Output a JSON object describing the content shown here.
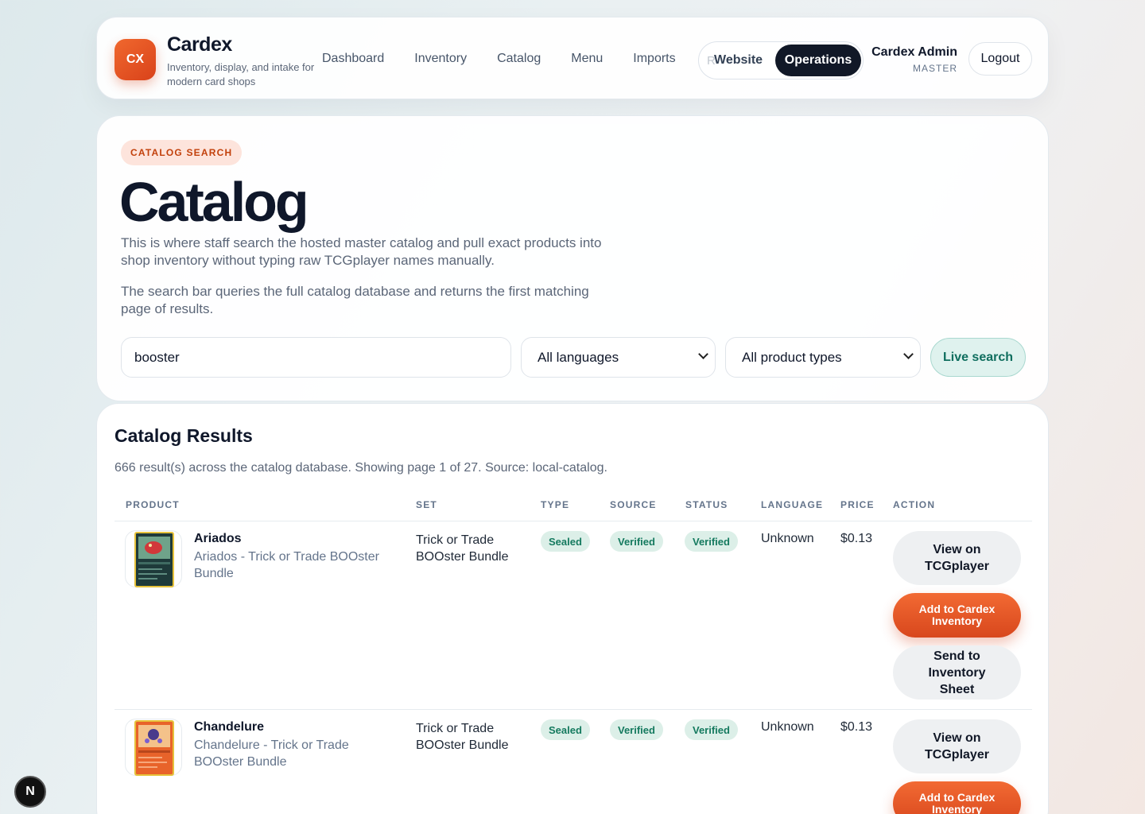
{
  "header": {
    "logo_text": "CX",
    "brand_name": "Cardex",
    "brand_tagline": "Inventory, display, and intake for modern card shops",
    "nav": [
      "Dashboard",
      "Inventory",
      "Catalog",
      "Menu",
      "Imports"
    ],
    "mode_ghost": "R",
    "mode_website": "Website",
    "mode_operations": "Operations",
    "user_name": "Cardex Admin",
    "user_role": "MASTER",
    "logout_label": "Logout"
  },
  "hero": {
    "eyebrow": "CATALOG SEARCH",
    "title": "Catalog",
    "paragraph1": "This is where staff search the hosted master catalog and pull exact products into shop inventory without typing raw TCGplayer names manually.",
    "paragraph2": "The search bar queries the full catalog database and returns the first matching page of results.",
    "search_value": "booster",
    "language_select": "All languages",
    "type_select": "All product types",
    "live_search_label": "Live search"
  },
  "results": {
    "title": "Catalog Results",
    "summary": "666 result(s) across the catalog database. Showing page 1 of 27. Source: local-catalog.",
    "columns": [
      "PRODUCT",
      "SET",
      "TYPE",
      "SOURCE",
      "STATUS",
      "LANGUAGE",
      "PRICE",
      "ACTION"
    ],
    "rows": [
      {
        "name": "Ariados",
        "subtitle": "Ariados - Trick or Trade BOOster Bundle",
        "set": "Trick or Trade BOOster Bundle",
        "type": "Sealed",
        "source": "Verified",
        "status": "Verified",
        "language": "Unknown",
        "price": "$0.13",
        "actions": [
          "View on TCGplayer",
          "Add to Cardex Inventory",
          "Send to Inventory Sheet"
        ]
      },
      {
        "name": "Chandelure",
        "subtitle": "Chandelure - Trick or Trade BOOster Bundle",
        "set": "Trick or Trade BOOster Bundle",
        "type": "Sealed",
        "source": "Verified",
        "status": "Verified",
        "language": "Unknown",
        "price": "$0.13",
        "actions": [
          "View on TCGplayer",
          "Add to Cardex Inventory"
        ]
      }
    ]
  },
  "dev_badge": "N",
  "colors": {
    "accent": "#e4552a",
    "dark": "#111827",
    "success": "#157a5f"
  }
}
